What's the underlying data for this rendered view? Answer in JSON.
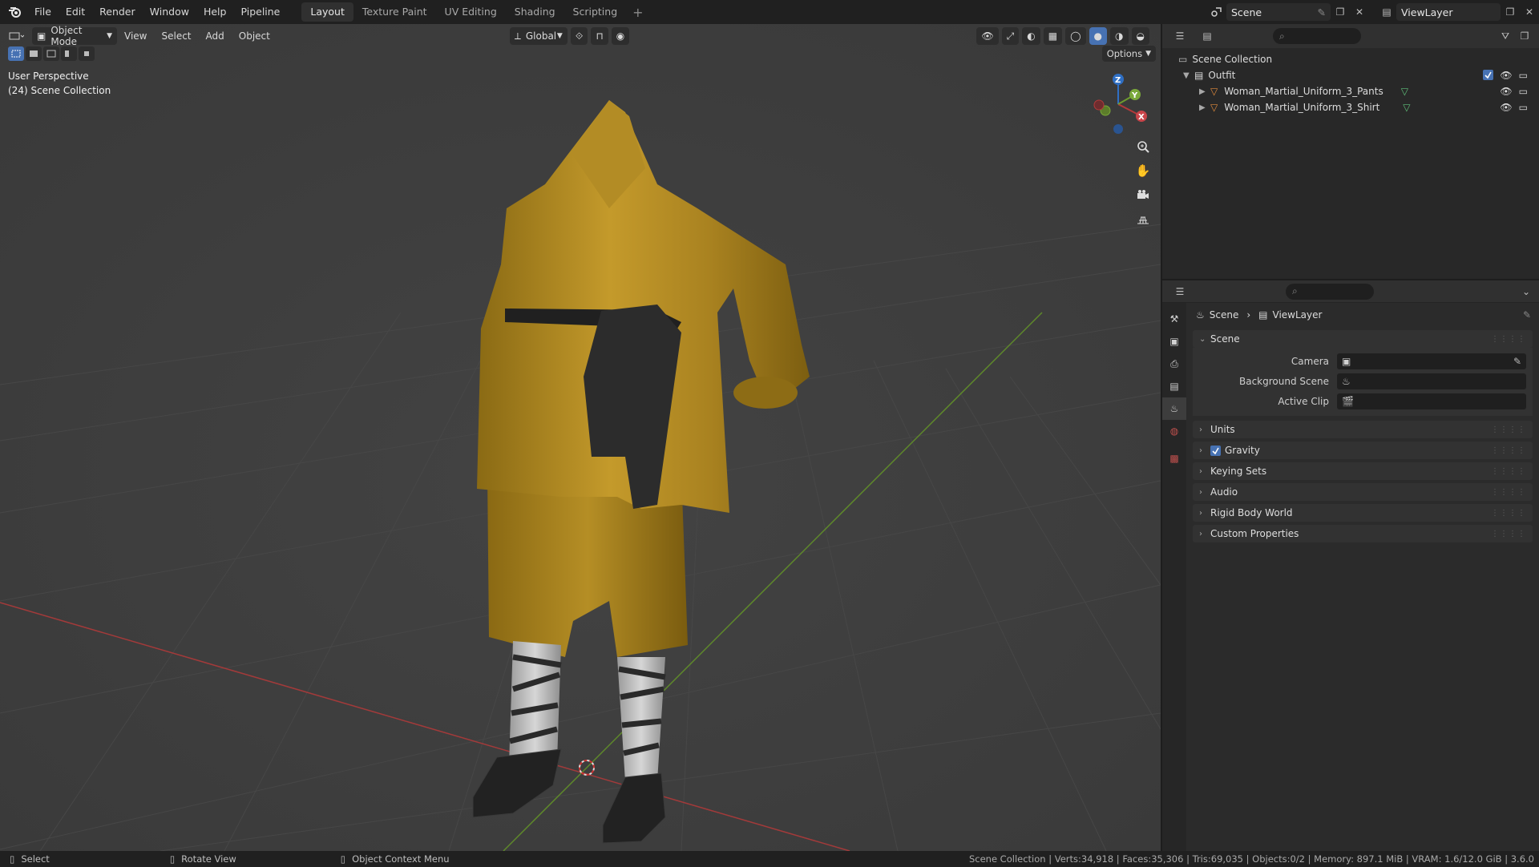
{
  "topbar": {
    "menus": [
      "File",
      "Edit",
      "Render",
      "Window",
      "Help",
      "Pipeline"
    ],
    "workspaces": [
      {
        "label": "Layout",
        "active": true
      },
      {
        "label": "Texture Paint",
        "active": false
      },
      {
        "label": "UV Editing",
        "active": false
      },
      {
        "label": "Shading",
        "active": false
      },
      {
        "label": "Scripting",
        "active": false
      }
    ],
    "add_workspace": "+",
    "scene_name": "Scene",
    "view_layer_name": "ViewLayer"
  },
  "viewport": {
    "mode_label": "Object Mode",
    "menus": [
      "View",
      "Select",
      "Add",
      "Object"
    ],
    "transform_orientation": "Global",
    "options_label": "Options",
    "perspective_label": "User Perspective",
    "collection_label": "(24) Scene Collection",
    "gizmo_axes": {
      "x": "X",
      "y": "Y",
      "z": "Z"
    },
    "colors": {
      "x_axis": "#b3393a",
      "y_axis": "#6e9c2e",
      "z_axis": "#2f6fc4",
      "background": "#3d3d3d"
    }
  },
  "outliner": {
    "root": "Scene Collection",
    "collection": "Outfit",
    "objects": [
      "Woman_Martial_Uniform_3_Pants",
      "Woman_Martial_Uniform_3_Shirt"
    ]
  },
  "properties": {
    "breadcrumb": {
      "scene": "Scene",
      "view_layer": "ViewLayer"
    },
    "scene_panel": {
      "title": "Scene",
      "fields": [
        {
          "label": "Camera",
          "value": ""
        },
        {
          "label": "Background Scene",
          "value": ""
        },
        {
          "label": "Active Clip",
          "value": ""
        }
      ]
    },
    "subpanels": [
      {
        "label": "Units",
        "checkbox": false
      },
      {
        "label": "Gravity",
        "checkbox": true
      },
      {
        "label": "Keying Sets",
        "checkbox": false
      },
      {
        "label": "Audio",
        "checkbox": false
      },
      {
        "label": "Rigid Body World",
        "checkbox": false
      },
      {
        "label": "Custom Properties",
        "checkbox": false
      }
    ]
  },
  "statusbar": {
    "left": [
      "Select",
      "Rotate View",
      "Object Context Menu"
    ],
    "stats": "Scene Collection | Verts:34,918 | Faces:35,306 | Tris:69,035 | Objects:0/2 | Memory: 897.1 MiB | VRAM: 1.6/12.0 GiB | 3.6.0"
  }
}
